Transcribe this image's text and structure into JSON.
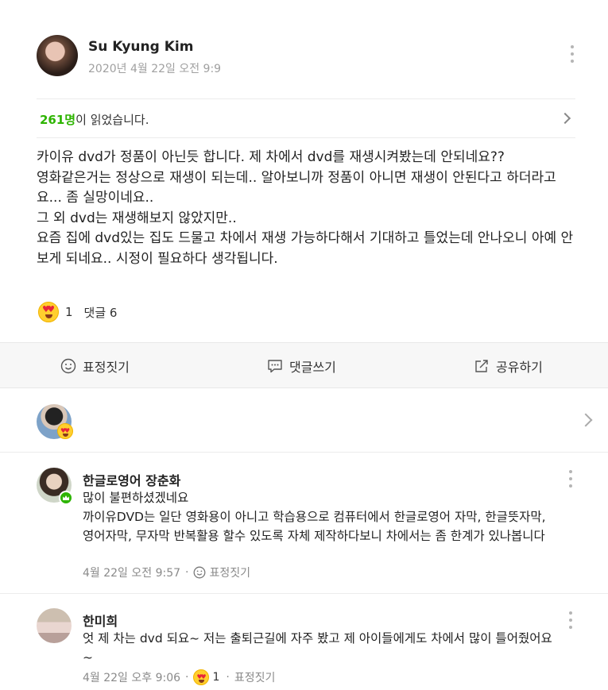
{
  "post": {
    "author_name": "Su Kyung Kim",
    "date": "2020년 4월 22일 오전 9:9",
    "readers_count": "261명",
    "readers_suffix": "이 읽었습니다.",
    "body": "카이유 dvd가 정품이 아닌듯 합니다. 제 차에서 dvd를 재생시켜봤는데 안되네요??\n영화같은거는 정상으로 재생이 되는데.. 알아보니까 정품이 아니면 재생이 안된다고 하더라고요... 좀 실망이네요..\n그 외 dvd는 재생해보지 않았지만..\n요즘 집에 dvd있는 집도 드물고 차에서 재생 가능하다해서 기대하고 틀었는데 안나오니 아예 안보게 되네요.. 시정이 필요하다 생각됩니다.",
    "reaction_count": "1",
    "comment_count_label": "댓글 6"
  },
  "actions": {
    "react_label": "표정짓기",
    "comment_label": "댓글쓰기",
    "share_label": "공유하기"
  },
  "comments": [
    {
      "name": "한글로영어 장춘화",
      "text": "많이 불편하셨겠네요\n까이유DVD는 일단 영화용이 아니고 학습용으로 컴퓨터에서 한글로영어 자막, 한글뜻자막, 영어자막, 무자막 반복활용 할수 있도록 자체 제작하다보니 차에서는 좀 한계가 있나봅니다",
      "time": "4월 22일 오전 9:57",
      "react_label": "표정짓기"
    },
    {
      "name": "한미희",
      "text": "엇 제 차는 dvd 되요~ 저는 출퇴근길에 자주 봤고 제 아이들에게도 차에서 많이 틀어줬어요~",
      "time": "4월 22일 오후 9:06",
      "reaction_count": "1",
      "react_label": "표정짓기"
    }
  ],
  "icons": [
    "kebab-menu-icon",
    "chevron-right-icon",
    "love-eyes-emoji-icon",
    "smiley-icon",
    "speech-bubble-icon",
    "share-icon",
    "crown-badge-icon"
  ],
  "colors": {
    "accent_green": "#2db400",
    "action_bar_bg": "#f7f7f7",
    "muted_text": "#a0a0a0"
  }
}
